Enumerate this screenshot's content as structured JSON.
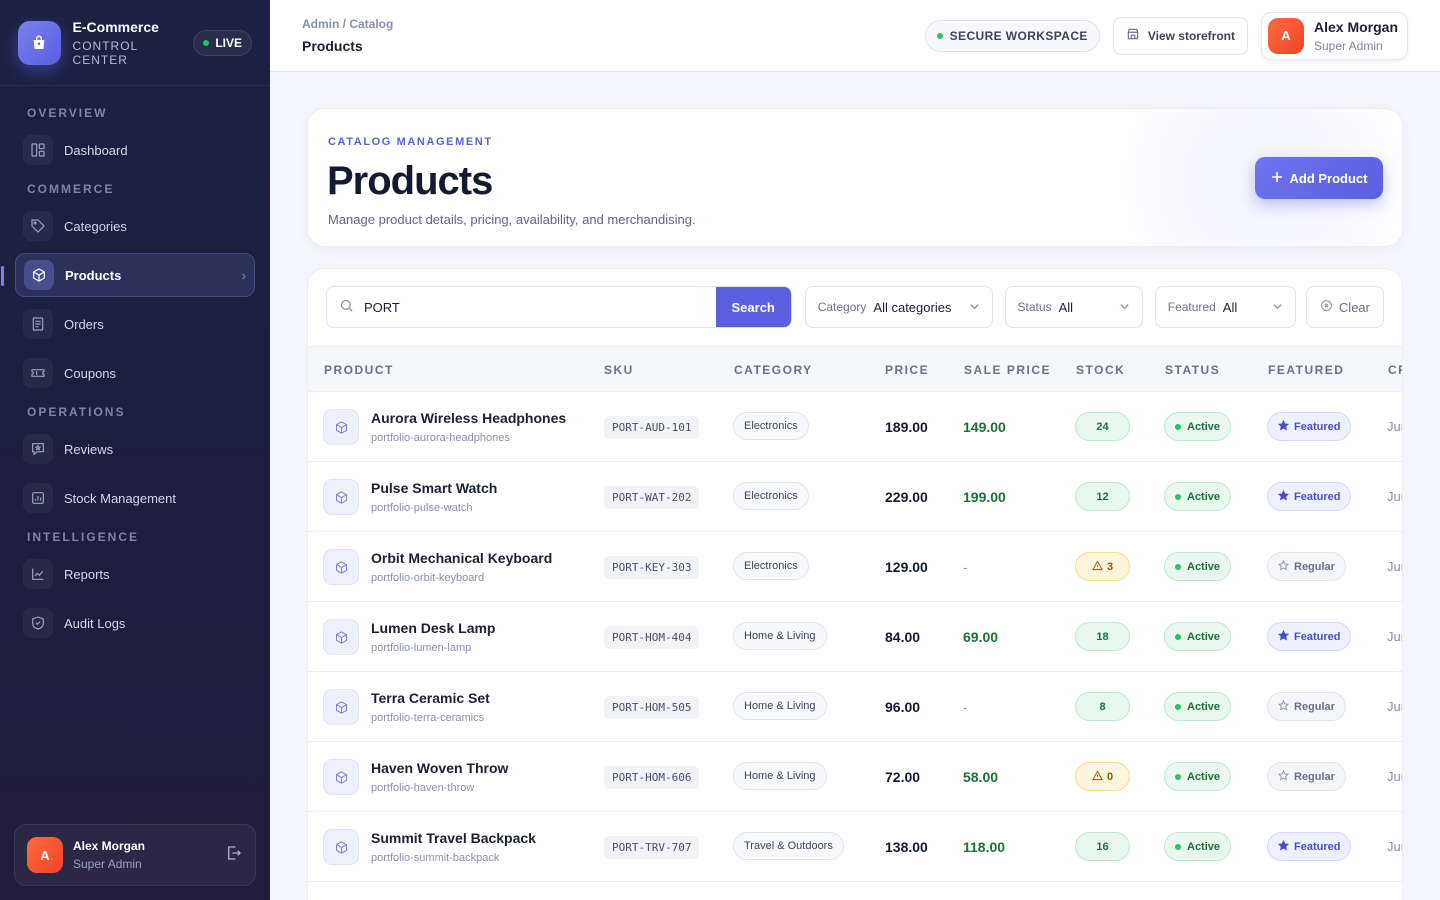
{
  "brand": {
    "title": "E-Commerce",
    "subtitle": "CONTROL CENTER",
    "live": "LIVE"
  },
  "nav": {
    "sections": [
      {
        "label": "OVERVIEW",
        "items": [
          {
            "label": "Dashboard",
            "icon": "dashboard-icon"
          }
        ]
      },
      {
        "label": "COMMERCE",
        "items": [
          {
            "label": "Categories",
            "icon": "tag-icon"
          },
          {
            "label": "Products",
            "icon": "box-icon",
            "active": true
          },
          {
            "label": "Orders",
            "icon": "receipt-icon"
          },
          {
            "label": "Coupons",
            "icon": "ticket-icon"
          }
        ]
      },
      {
        "label": "OPERATIONS",
        "items": [
          {
            "label": "Reviews",
            "icon": "review-icon"
          },
          {
            "label": "Stock Management",
            "icon": "stock-icon"
          }
        ]
      },
      {
        "label": "INTELLIGENCE",
        "items": [
          {
            "label": "Reports",
            "icon": "chart-icon"
          },
          {
            "label": "Audit Logs",
            "icon": "shield-icon"
          }
        ]
      }
    ]
  },
  "user": {
    "initial": "A",
    "name": "Alex Morgan",
    "role": "Super Admin"
  },
  "topbar": {
    "breadcrumb": "Admin / Catalog",
    "page": "Products",
    "secure": "SECURE WORKSPACE",
    "storefront": "View storefront"
  },
  "hero": {
    "eyebrow": "CATALOG MANAGEMENT",
    "title": "Products",
    "description": "Manage product details, pricing, availability, and merchandising.",
    "add_button": "Add Product"
  },
  "filters": {
    "search_value": "PORT",
    "search_button": "Search",
    "category_label": "Category",
    "category_value": "All categories",
    "status_label": "Status",
    "status_value": "All",
    "featured_label": "Featured",
    "featured_value": "All",
    "clear": "Clear"
  },
  "table": {
    "columns": [
      "PRODUCT",
      "SKU",
      "CATEGORY",
      "PRICE",
      "SALE PRICE",
      "STOCK",
      "STATUS",
      "FEATURED",
      "CR"
    ],
    "rows": [
      {
        "name": "Aurora Wireless Headphones",
        "slug": "portfolio-aurora-headphones",
        "sku": "PORT-AUD-101",
        "category": "Electronics",
        "price": "189.00",
        "sale": "149.00",
        "stock": "24",
        "low": false,
        "status": "Active",
        "featured": "Featured",
        "created": "Jun"
      },
      {
        "name": "Pulse Smart Watch",
        "slug": "portfolio-pulse-watch",
        "sku": "PORT-WAT-202",
        "category": "Electronics",
        "price": "229.00",
        "sale": "199.00",
        "stock": "12",
        "low": false,
        "status": "Active",
        "featured": "Featured",
        "created": "Jun"
      },
      {
        "name": "Orbit Mechanical Keyboard",
        "slug": "portfolio-orbit-keyboard",
        "sku": "PORT-KEY-303",
        "category": "Electronics",
        "price": "129.00",
        "sale": "-",
        "stock": "3",
        "low": true,
        "status": "Active",
        "featured": "Regular",
        "created": "Jun"
      },
      {
        "name": "Lumen Desk Lamp",
        "slug": "portfolio-lumen-lamp",
        "sku": "PORT-HOM-404",
        "category": "Home & Living",
        "price": "84.00",
        "sale": "69.00",
        "stock": "18",
        "low": false,
        "status": "Active",
        "featured": "Featured",
        "created": "Jun"
      },
      {
        "name": "Terra Ceramic Set",
        "slug": "portfolio-terra-ceramics",
        "sku": "PORT-HOM-505",
        "category": "Home & Living",
        "price": "96.00",
        "sale": "-",
        "stock": "8",
        "low": false,
        "status": "Active",
        "featured": "Regular",
        "created": "Jun"
      },
      {
        "name": "Haven Woven Throw",
        "slug": "portfolio-haven-throw",
        "sku": "PORT-HOM-606",
        "category": "Home & Living",
        "price": "72.00",
        "sale": "58.00",
        "stock": "0",
        "low": true,
        "status": "Active",
        "featured": "Regular",
        "created": "Jun"
      },
      {
        "name": "Summit Travel Backpack",
        "slug": "portfolio-summit-backpack",
        "sku": "PORT-TRV-707",
        "category": "Travel & Outdoors",
        "price": "138.00",
        "sale": "118.00",
        "stock": "16",
        "low": false,
        "status": "Active",
        "featured": "Featured",
        "created": "Jun"
      }
    ]
  }
}
